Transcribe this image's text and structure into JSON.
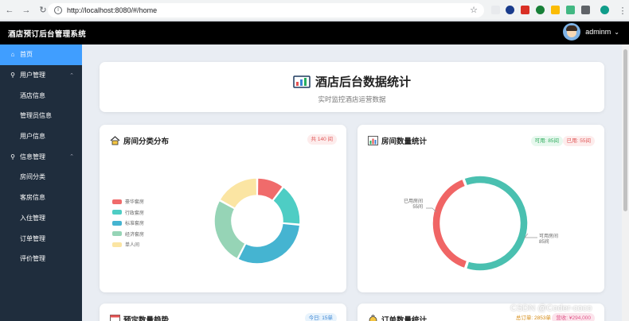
{
  "browser": {
    "url": "http://localhost:8080/#/home"
  },
  "header": {
    "title": "酒店预订后台管理系统",
    "username": "adminm"
  },
  "sidebar": {
    "items": [
      {
        "label": "首页",
        "level": "top",
        "icon": "home-icon",
        "active": true
      },
      {
        "label": "用户管理",
        "level": "top",
        "icon": "user-icon",
        "expanded": true
      },
      {
        "label": "酒店信息",
        "level": "sub"
      },
      {
        "label": "管理员信息",
        "level": "sub"
      },
      {
        "label": "用户信息",
        "level": "sub"
      },
      {
        "label": "信息管理",
        "level": "top",
        "icon": "user-icon",
        "expanded": true
      },
      {
        "label": "房间分类",
        "level": "sub"
      },
      {
        "label": "客房信息",
        "level": "sub"
      },
      {
        "label": "入住管理",
        "level": "sub"
      },
      {
        "label": "订单管理",
        "level": "sub"
      },
      {
        "label": "评价管理",
        "level": "sub"
      }
    ]
  },
  "hero": {
    "title": "酒店后台数据统计",
    "subtitle": "实时监控酒店运营数据"
  },
  "room_type_panel": {
    "title": "房间分类分布",
    "badge": "共 140 间",
    "colors": {
      "badge_bg": "#fdecec",
      "badge_text": "#e05656"
    }
  },
  "room_count_panel": {
    "title": "房间数量统计",
    "badge_available": "可用: 85间",
    "badge_used": "已用: 55间",
    "colors": {
      "available_bg": "#e7f8ee",
      "available_text": "#2eab5c",
      "used_bg": "#fdecec",
      "used_text": "#e05656"
    },
    "label_used": [
      "已用房间",
      "55间"
    ],
    "label_available": [
      "可用房间",
      "85间"
    ]
  },
  "bottom_left_panel": {
    "title": "预定数量趋势",
    "badge": "今日: 15单"
  },
  "bottom_right_panel": {
    "title": "订单数量统计",
    "badge_total": "总订单: 2853单",
    "badge_money": "营收: ¥294,000"
  },
  "watermark": "CSDN @Coder-coco",
  "chart_data": [
    {
      "type": "pie",
      "variant": "donut",
      "categories": [
        "豪华套房",
        "行政套房",
        "标准套房",
        "经济套房",
        "单人间"
      ],
      "values": [
        11,
        17,
        33,
        27,
        18
      ],
      "colors": [
        "#f06b6b",
        "#4ecdc4",
        "#45b4d1",
        "#96d4b6",
        "#fbe5a3"
      ],
      "legend": "left"
    },
    {
      "type": "pie",
      "variant": "donut",
      "categories": [
        "已用房间",
        "可用房间"
      ],
      "values": [
        55,
        85
      ],
      "colors": [
        "#f06565",
        "#4ac0b0"
      ],
      "legend": "none"
    }
  ]
}
